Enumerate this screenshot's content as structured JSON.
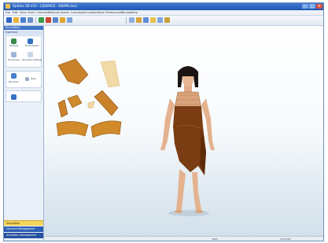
{
  "window": {
    "title": "Optitex 3D V10 - [3DSPACE - DRAPE.dsn]"
  },
  "menu": [
    "File",
    "Edit",
    "View",
    "Insert",
    "Garment",
    "Material",
    "Avatar",
    "Colorway",
    "Simulation",
    "Tools",
    "Preferences",
    "Window",
    "Help"
  ],
  "sidebar": {
    "header": "Simulation",
    "group_title": "Garment",
    "buttons": [
      "Garment",
      "Fit Simulation",
      "Pre-Process",
      "Simulation Settings"
    ],
    "tools": [
      "Pick Point",
      "Place"
    ],
    "bottom_items": [
      "Simulation",
      "Garment Management",
      "Animation Management"
    ]
  },
  "status": {
    "left": "NUM",
    "right": "CAP  SCRL"
  },
  "colors": {
    "accent": "#3e73c6",
    "garment": "#7a3c12",
    "pattern_piece": "#d18a2a",
    "bottom_item_active": "#f3d35a"
  },
  "icons": [
    "new-file-icon",
    "open-folder-icon",
    "save-icon",
    "undo-icon",
    "redo-icon",
    "cut-icon",
    "help-icon",
    "rotate-icon",
    "zoom-icon",
    "pan-icon",
    "front-view-icon",
    "side-view-icon"
  ]
}
